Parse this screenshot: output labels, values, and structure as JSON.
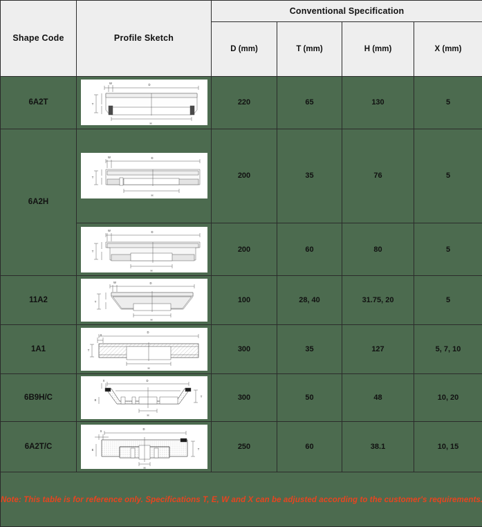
{
  "table": {
    "headers": {
      "shape_code": "Shape Code",
      "profile_sketch": "Profile Sketch",
      "group": "Conventional Specification",
      "d": "D (mm)",
      "t": "T (mm)",
      "h": "H (mm)",
      "x": "X (mm)"
    },
    "rows": [
      {
        "code": "6A2T",
        "sketch": "grinding-wheel-6a2t-profile",
        "d": "220",
        "t": "65",
        "h": "130",
        "x": "5"
      },
      {
        "code": "6A2H",
        "sketch": "grinding-wheel-6a2h-flat-profile",
        "d": "200",
        "t": "35",
        "h": "76",
        "x": "5"
      },
      {
        "code": "",
        "sketch": "grinding-wheel-6a2h-deep-profile",
        "d": "200",
        "t": "60",
        "h": "80",
        "x": "5"
      },
      {
        "code": "11A2",
        "sketch": "grinding-wheel-11a2-profile",
        "d": "100",
        "t": "28, 40",
        "h": "31.75, 20",
        "x": "5"
      },
      {
        "code": "1A1",
        "sketch": "grinding-wheel-1a1-profile",
        "d": "300",
        "t": "35",
        "h": "127",
        "x": "5, 7, 10"
      },
      {
        "code": "6B9H/C",
        "sketch": "grinding-wheel-6b9hc-profile",
        "d": "300",
        "t": "50",
        "h": "48",
        "x": "10, 20"
      },
      {
        "code": "6A2T/C",
        "sketch": "grinding-wheel-6a2tc-profile",
        "d": "250",
        "t": "60",
        "h": "38.1",
        "x": "10, 15"
      }
    ],
    "note": "Note: This table is for reference only.  Specifications T, E, W and X can be adjusted according to the customer's requirements.",
    "colors": {
      "cell_background": "#4c6b4f",
      "header_background": "#eeeeee",
      "border": "#2b2b2b",
      "note_text": "#e8441f",
      "sketch_background": "#ffffff"
    },
    "sketch_dimension_labels": [
      "D",
      "H",
      "T",
      "W",
      "E"
    ]
  }
}
